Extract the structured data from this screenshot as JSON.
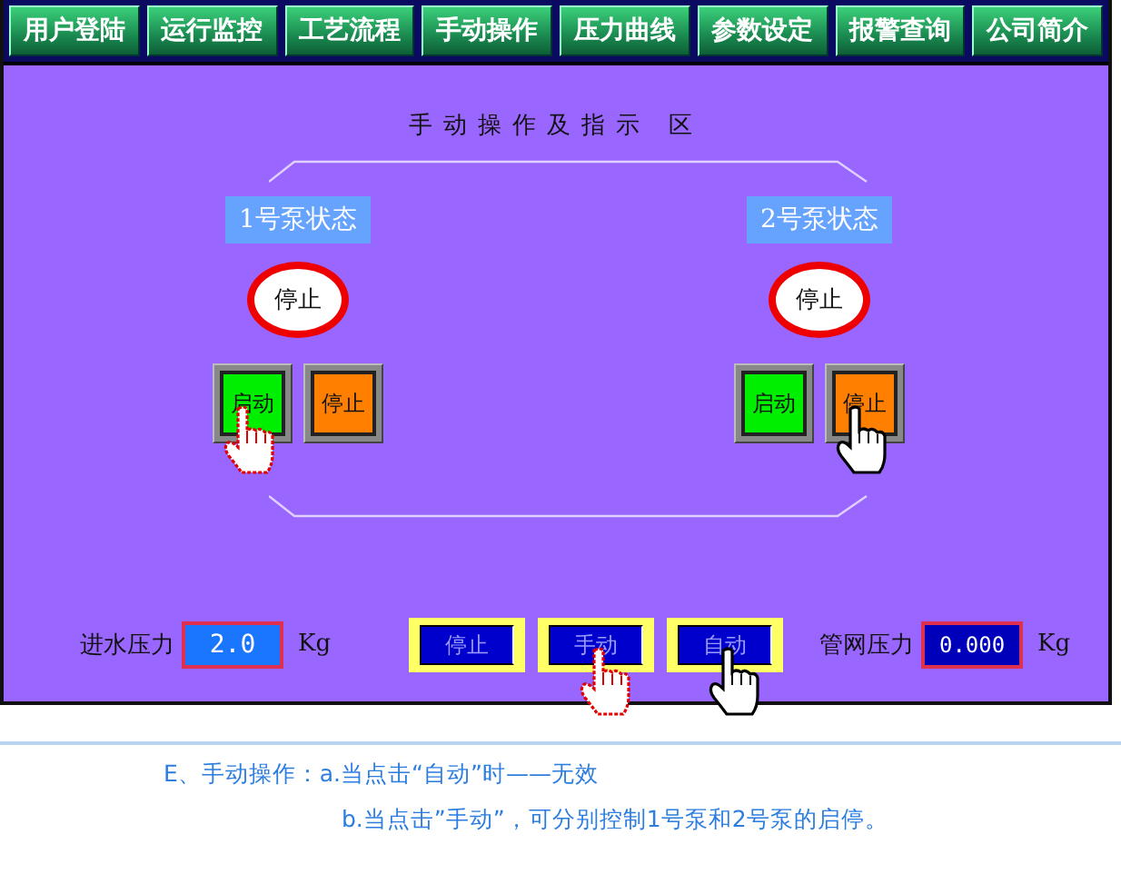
{
  "nav": [
    {
      "label": "用户登陆"
    },
    {
      "label": "运行监控"
    },
    {
      "label": "工艺流程"
    },
    {
      "label": "手动操作"
    },
    {
      "label": "压力曲线"
    },
    {
      "label": "参数设定"
    },
    {
      "label": "报警查询"
    },
    {
      "label": "公司简介"
    }
  ],
  "title": "手动操作及指示 区",
  "pumps": [
    {
      "label": "1号泵状态",
      "status": "停止",
      "buttons": [
        {
          "label": "启动",
          "kind": "start",
          "hand_cursor": true,
          "clicked": true
        },
        {
          "label": "停止",
          "kind": "stop",
          "hand_cursor": false
        }
      ]
    },
    {
      "label": "2号泵状态",
      "status": "停止",
      "buttons": [
        {
          "label": "启动",
          "kind": "start",
          "hand_cursor": false
        },
        {
          "label": "停止",
          "kind": "stop",
          "hand_cursor": true,
          "clicked": false
        }
      ]
    }
  ],
  "inlet": {
    "label": "进水压力",
    "value": "2.0",
    "unit": "Kg"
  },
  "modes": [
    {
      "label": "停止",
      "hand_cursor": false
    },
    {
      "label": "手动",
      "hand_cursor": true,
      "clicked": true
    },
    {
      "label": "自动",
      "hand_cursor": true,
      "clicked": false
    }
  ],
  "network": {
    "label": "管网压力",
    "value": "0.000",
    "unit": "Kg"
  },
  "caption": [
    "E、手动操作：a.当点击“自动”时——无效",
    "b.当点击”手动”，可分别控制1号泵和2号泵的启停。"
  ]
}
